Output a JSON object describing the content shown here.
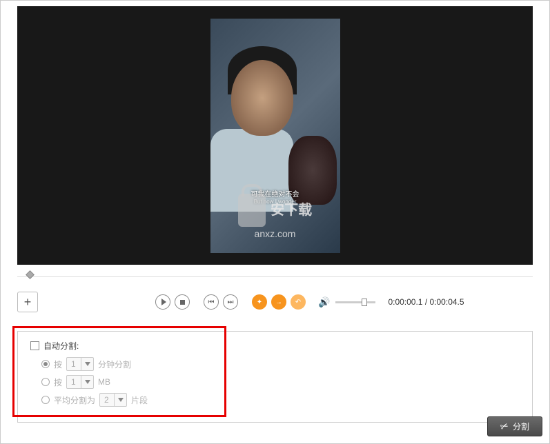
{
  "preview": {
    "subtitle_cn": "可我在绝对不会",
    "subtitle_en": "But now I wonder",
    "watermark_text": "安下载",
    "watermark_url": "anxz.com"
  },
  "controls": {
    "time_current": "0:00:00.1",
    "time_total": "0:00:04.5"
  },
  "auto_split": {
    "title": "自动分割:",
    "opt1_prefix": "按",
    "opt1_value": "1",
    "opt1_suffix": "分钟分割",
    "opt2_prefix": "按",
    "opt2_value": "1",
    "opt2_suffix": "MB",
    "opt3_prefix": "平均分割为",
    "opt3_value": "2",
    "opt3_suffix": "片段"
  },
  "footer": {
    "split_label": "分割"
  }
}
